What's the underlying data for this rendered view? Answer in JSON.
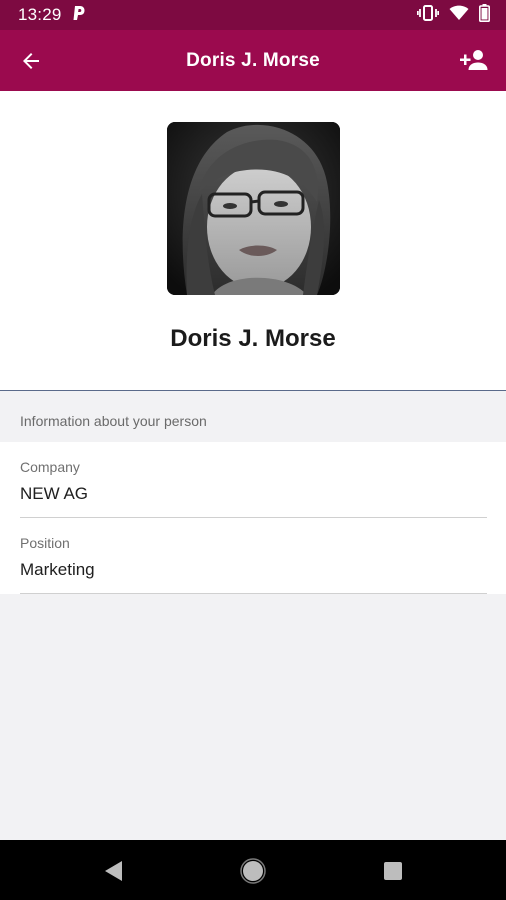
{
  "status_bar": {
    "time": "13:29",
    "left_icons": [
      "parking-p-icon"
    ],
    "right_icons": [
      "vibrate-icon",
      "wifi-icon",
      "battery-icon"
    ]
  },
  "app_bar": {
    "title": "Doris J. Morse",
    "left_icon": "arrow-back-icon",
    "right_icon": "add-person-icon",
    "color": "#9b0a4e"
  },
  "profile": {
    "name": "Doris J. Morse"
  },
  "details": {
    "section_title": "Information about your person",
    "fields": [
      {
        "label": "Company",
        "value": "NEW AG"
      },
      {
        "label": "Position",
        "value": "Marketing"
      }
    ]
  },
  "nav_bar": {
    "buttons": [
      "back-triangle-icon",
      "home-circle-icon",
      "recents-square-icon"
    ]
  }
}
